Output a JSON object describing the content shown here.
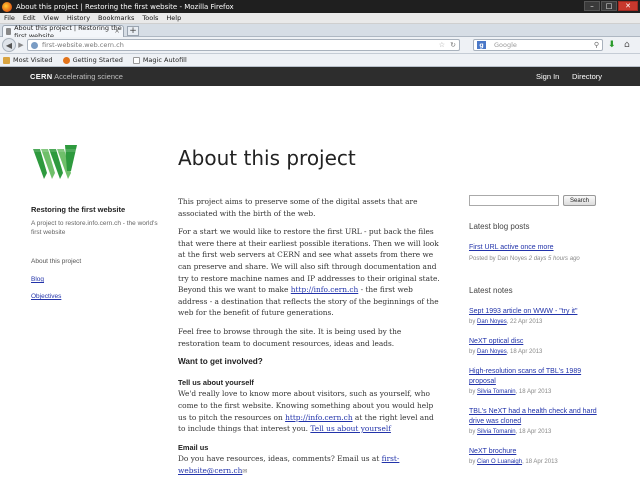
{
  "browser": {
    "window_title": "About this project | Restoring the first website - Mozilla Firefox",
    "menu": [
      "File",
      "Edit",
      "View",
      "History",
      "Bookmarks",
      "Tools",
      "Help"
    ],
    "tab_title": "About this project | Restoring the first website",
    "url": "first-website.web.cern.ch",
    "search_placeholder": "Google",
    "bookmarks": [
      "Most Visited",
      "Getting Started",
      "Magic Autofill"
    ],
    "win_minimize": "–",
    "win_maximize": "□",
    "win_close": "✕",
    "new_tab": "+",
    "tab_close": "×"
  },
  "site": {
    "brand_bold": "CERN",
    "brand_tagline": "Accelerating science",
    "signin": "Sign In",
    "directory": "Directory",
    "title": "Restoring the first website",
    "description": "A project to restore.info.cern.ch - the world's first website",
    "nav": {
      "active": "About this project",
      "blog": "Blog",
      "objectives": "Objectives"
    }
  },
  "main": {
    "heading": "About this project",
    "p1": "This project aims to preserve some of the digital assets that are associated with the birth of the web.",
    "p2_a": "For a start we would like to restore the first URL - put back the files that were there at their earliest possible iterations. Then we will look at the first web servers at CERN and see what assets from there we can preserve and share. We will also sift through documentation and try to restore machine names and IP addresses to their original state. Beyond this we want to make ",
    "p2_link": "http://info.cern.ch",
    "p2_b": " - the first web address - a destination that reflects the story of the beginnings of the web for the benefit of future generations.",
    "p3": "Feel free to browse through the site. It is being used by the restoration team to document resources, ideas and leads.",
    "h_involved": "Want to get involved?",
    "h_tell": "Tell us about yourself",
    "p4_a": "We'd really love to know more about visitors, such as yourself, who come to the first website. Knowing something about you would help us to pitch the resources on ",
    "p4_link": "http://info.cern.ch",
    "p4_b": " at the right level and to include things that interest you. ",
    "p4_link2": "Tell us about yourself",
    "h_email": "Email us",
    "p5_a": "Do you have resources, ideas, comments? Email us at ",
    "p5_link": "first-website@cern.ch"
  },
  "sidebar": {
    "search_button": "Search",
    "blog_heading": "Latest blog posts",
    "blog_post": "First URL active once more",
    "blog_meta_prefix": "Posted by Dan Noyes",
    "blog_meta_time": "2 days 5 hours ago",
    "notes_heading": "Latest notes",
    "notes": [
      {
        "title": "Sept 1993 article on WWW - \"try it\"",
        "by": "by",
        "author": "Dan Noyes",
        "date": ", 22 Apr 2013"
      },
      {
        "title": "NeXT optical disc",
        "by": "by",
        "author": "Dan Noyes",
        "date": ", 18 Apr 2013"
      },
      {
        "title": "High-resolution scans of TBL's 1989 proposal",
        "by": "by",
        "author": "Silvia Tomanin",
        "date": ", 18 Apr 2013"
      },
      {
        "title": "TBL's NeXT had a health check and hard drive was cloned",
        "by": "by",
        "author": "Silvia Tomanin",
        "date": ", 18 Apr 2013"
      },
      {
        "title": "NeXT brochure",
        "by": "by",
        "author": "Cian O Luanaigh",
        "date": ", 18 Apr 2013"
      }
    ]
  },
  "icons": {
    "back": "back-arrow-icon",
    "forward": "forward-arrow-icon",
    "star": "bookmark-star-icon",
    "reload": "reload-icon",
    "search": "magnifier-icon",
    "download": "download-arrow-icon",
    "home": "home-icon"
  },
  "colors": {
    "cern_bar": "#2d2d2d",
    "link": "#2233aa",
    "logo_green": "#2e9a3e"
  }
}
